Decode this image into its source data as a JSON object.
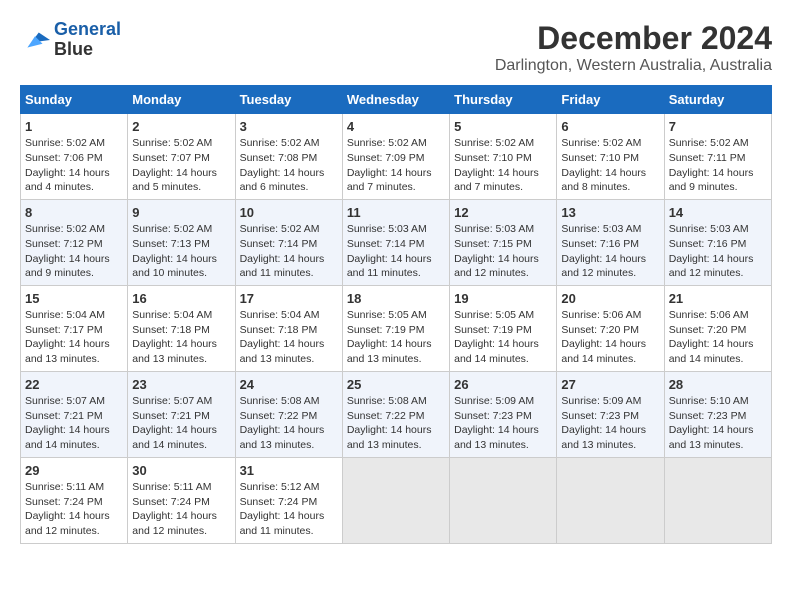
{
  "logo": {
    "line1": "General",
    "line2": "Blue"
  },
  "title": "December 2024",
  "subtitle": "Darlington, Western Australia, Australia",
  "days_header": [
    "Sunday",
    "Monday",
    "Tuesday",
    "Wednesday",
    "Thursday",
    "Friday",
    "Saturday"
  ],
  "weeks": [
    [
      {
        "day": "1",
        "info": "Sunrise: 5:02 AM\nSunset: 7:06 PM\nDaylight: 14 hours\nand 4 minutes."
      },
      {
        "day": "2",
        "info": "Sunrise: 5:02 AM\nSunset: 7:07 PM\nDaylight: 14 hours\nand 5 minutes."
      },
      {
        "day": "3",
        "info": "Sunrise: 5:02 AM\nSunset: 7:08 PM\nDaylight: 14 hours\nand 6 minutes."
      },
      {
        "day": "4",
        "info": "Sunrise: 5:02 AM\nSunset: 7:09 PM\nDaylight: 14 hours\nand 7 minutes."
      },
      {
        "day": "5",
        "info": "Sunrise: 5:02 AM\nSunset: 7:10 PM\nDaylight: 14 hours\nand 7 minutes."
      },
      {
        "day": "6",
        "info": "Sunrise: 5:02 AM\nSunset: 7:10 PM\nDaylight: 14 hours\nand 8 minutes."
      },
      {
        "day": "7",
        "info": "Sunrise: 5:02 AM\nSunset: 7:11 PM\nDaylight: 14 hours\nand 9 minutes."
      }
    ],
    [
      {
        "day": "8",
        "info": "Sunrise: 5:02 AM\nSunset: 7:12 PM\nDaylight: 14 hours\nand 9 minutes."
      },
      {
        "day": "9",
        "info": "Sunrise: 5:02 AM\nSunset: 7:13 PM\nDaylight: 14 hours\nand 10 minutes."
      },
      {
        "day": "10",
        "info": "Sunrise: 5:02 AM\nSunset: 7:14 PM\nDaylight: 14 hours\nand 11 minutes."
      },
      {
        "day": "11",
        "info": "Sunrise: 5:03 AM\nSunset: 7:14 PM\nDaylight: 14 hours\nand 11 minutes."
      },
      {
        "day": "12",
        "info": "Sunrise: 5:03 AM\nSunset: 7:15 PM\nDaylight: 14 hours\nand 12 minutes."
      },
      {
        "day": "13",
        "info": "Sunrise: 5:03 AM\nSunset: 7:16 PM\nDaylight: 14 hours\nand 12 minutes."
      },
      {
        "day": "14",
        "info": "Sunrise: 5:03 AM\nSunset: 7:16 PM\nDaylight: 14 hours\nand 12 minutes."
      }
    ],
    [
      {
        "day": "15",
        "info": "Sunrise: 5:04 AM\nSunset: 7:17 PM\nDaylight: 14 hours\nand 13 minutes."
      },
      {
        "day": "16",
        "info": "Sunrise: 5:04 AM\nSunset: 7:18 PM\nDaylight: 14 hours\nand 13 minutes."
      },
      {
        "day": "17",
        "info": "Sunrise: 5:04 AM\nSunset: 7:18 PM\nDaylight: 14 hours\nand 13 minutes."
      },
      {
        "day": "18",
        "info": "Sunrise: 5:05 AM\nSunset: 7:19 PM\nDaylight: 14 hours\nand 13 minutes."
      },
      {
        "day": "19",
        "info": "Sunrise: 5:05 AM\nSunset: 7:19 PM\nDaylight: 14 hours\nand 14 minutes."
      },
      {
        "day": "20",
        "info": "Sunrise: 5:06 AM\nSunset: 7:20 PM\nDaylight: 14 hours\nand 14 minutes."
      },
      {
        "day": "21",
        "info": "Sunrise: 5:06 AM\nSunset: 7:20 PM\nDaylight: 14 hours\nand 14 minutes."
      }
    ],
    [
      {
        "day": "22",
        "info": "Sunrise: 5:07 AM\nSunset: 7:21 PM\nDaylight: 14 hours\nand 14 minutes."
      },
      {
        "day": "23",
        "info": "Sunrise: 5:07 AM\nSunset: 7:21 PM\nDaylight: 14 hours\nand 14 minutes."
      },
      {
        "day": "24",
        "info": "Sunrise: 5:08 AM\nSunset: 7:22 PM\nDaylight: 14 hours\nand 13 minutes."
      },
      {
        "day": "25",
        "info": "Sunrise: 5:08 AM\nSunset: 7:22 PM\nDaylight: 14 hours\nand 13 minutes."
      },
      {
        "day": "26",
        "info": "Sunrise: 5:09 AM\nSunset: 7:23 PM\nDaylight: 14 hours\nand 13 minutes."
      },
      {
        "day": "27",
        "info": "Sunrise: 5:09 AM\nSunset: 7:23 PM\nDaylight: 14 hours\nand 13 minutes."
      },
      {
        "day": "28",
        "info": "Sunrise: 5:10 AM\nSunset: 7:23 PM\nDaylight: 14 hours\nand 13 minutes."
      }
    ],
    [
      {
        "day": "29",
        "info": "Sunrise: 5:11 AM\nSunset: 7:24 PM\nDaylight: 14 hours\nand 12 minutes."
      },
      {
        "day": "30",
        "info": "Sunrise: 5:11 AM\nSunset: 7:24 PM\nDaylight: 14 hours\nand 12 minutes."
      },
      {
        "day": "31",
        "info": "Sunrise: 5:12 AM\nSunset: 7:24 PM\nDaylight: 14 hours\nand 11 minutes."
      },
      {
        "day": "",
        "info": ""
      },
      {
        "day": "",
        "info": ""
      },
      {
        "day": "",
        "info": ""
      },
      {
        "day": "",
        "info": ""
      }
    ]
  ]
}
